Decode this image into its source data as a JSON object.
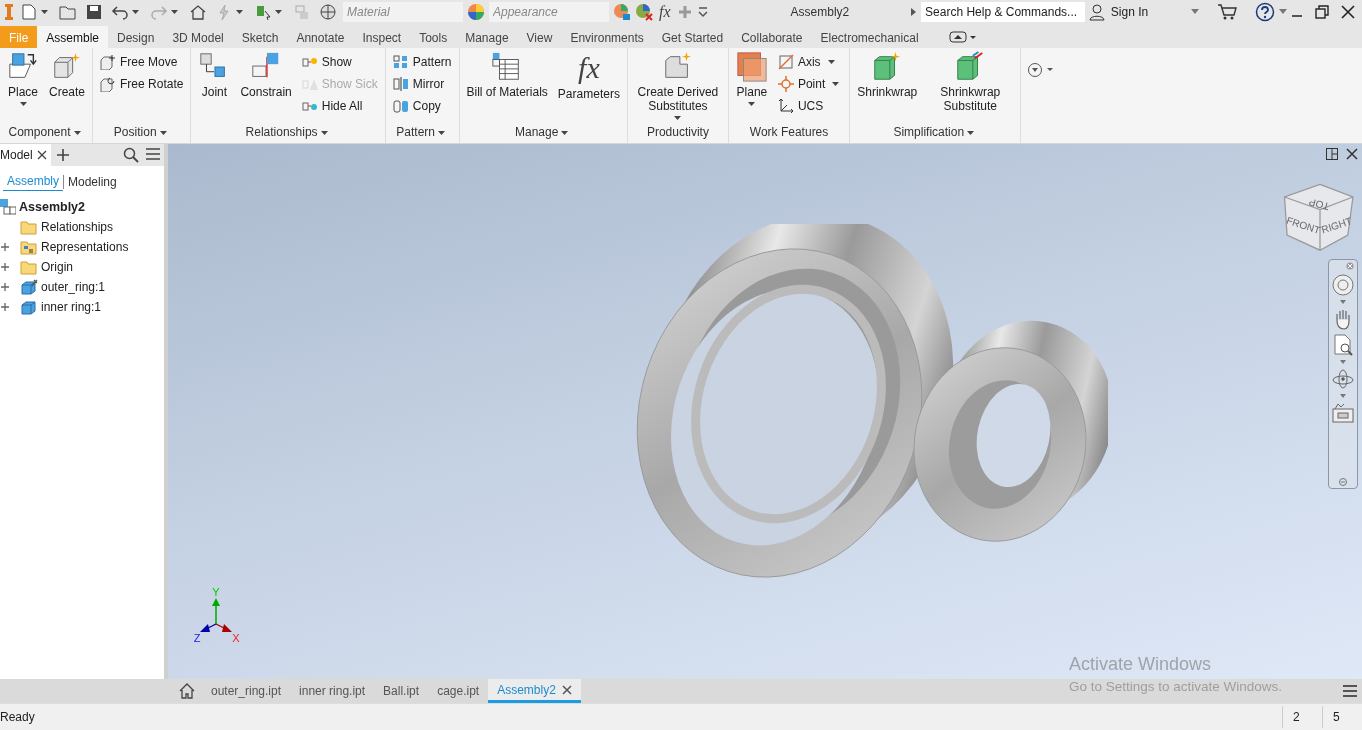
{
  "title_bar": {
    "material": {
      "placeholder": "Material"
    },
    "appearance": {
      "placeholder": "Appearance"
    },
    "formula_glyph": "fx",
    "document_title": "Assembly2",
    "search": {
      "placeholder": "Search Help & Commands..."
    },
    "sign_in": "Sign In"
  },
  "ribbon_tabs": [
    {
      "label": "File",
      "kind": "file",
      "selected": false
    },
    {
      "label": "Assemble",
      "kind": "tab",
      "selected": true
    },
    {
      "label": "Design",
      "kind": "tab",
      "selected": false
    },
    {
      "label": "3D Model",
      "kind": "tab",
      "selected": false
    },
    {
      "label": "Sketch",
      "kind": "tab",
      "selected": false
    },
    {
      "label": "Annotate",
      "kind": "tab",
      "selected": false
    },
    {
      "label": "Inspect",
      "kind": "tab",
      "selected": false
    },
    {
      "label": "Tools",
      "kind": "tab",
      "selected": false
    },
    {
      "label": "Manage",
      "kind": "tab",
      "selected": false
    },
    {
      "label": "View",
      "kind": "tab",
      "selected": false
    },
    {
      "label": "Environments",
      "kind": "tab",
      "selected": false
    },
    {
      "label": "Get Started",
      "kind": "tab",
      "selected": false
    },
    {
      "label": "Collaborate",
      "kind": "tab",
      "selected": false
    },
    {
      "label": "Electromechanical",
      "kind": "tab",
      "selected": false
    }
  ],
  "ribbon_panels": [
    {
      "label": "Component",
      "menu": true,
      "tools": [
        {
          "label": "Place",
          "kind": "large",
          "dropdown": true,
          "disabled": false
        },
        {
          "label": "Create",
          "kind": "large",
          "dropdown": false,
          "disabled": false
        }
      ]
    },
    {
      "label": "Position",
      "menu": true,
      "tools": [
        {
          "label": "Free Move",
          "kind": "small",
          "dropdown": false,
          "disabled": false
        },
        {
          "label": "Free Rotate",
          "kind": "small",
          "dropdown": false,
          "disabled": false
        }
      ]
    },
    {
      "label": "Relationships",
      "menu": true,
      "tools": [
        {
          "label": "Joint",
          "kind": "large",
          "dropdown": false,
          "disabled": false
        },
        {
          "label": "Constrain",
          "kind": "large",
          "dropdown": false,
          "disabled": false
        },
        {
          "label": "Show",
          "kind": "small",
          "dropdown": false,
          "disabled": false
        },
        {
          "label": "Show Sick",
          "kind": "small",
          "dropdown": false,
          "disabled": true
        },
        {
          "label": "Hide All",
          "kind": "small",
          "dropdown": false,
          "disabled": false
        }
      ]
    },
    {
      "label": "Pattern",
      "menu": true,
      "tools": [
        {
          "label": "Pattern",
          "kind": "small",
          "dropdown": false,
          "disabled": false
        },
        {
          "label": "Mirror",
          "kind": "small",
          "dropdown": false,
          "disabled": false
        },
        {
          "label": "Copy",
          "kind": "small",
          "dropdown": false,
          "disabled": false
        }
      ]
    },
    {
      "label": "Manage",
      "menu": true,
      "tools": [
        {
          "label": "Bill of Materials",
          "kind": "large",
          "dropdown": false,
          "disabled": false
        },
        {
          "label": "Parameters",
          "kind": "large",
          "dropdown": false,
          "disabled": false,
          "glyph": "fx"
        }
      ]
    },
    {
      "label": "Productivity",
      "menu": false,
      "tools": [
        {
          "label": "Create Derived Substitutes",
          "kind": "large",
          "dropdown": true,
          "disabled": false
        }
      ]
    },
    {
      "label": "Work Features",
      "menu": false,
      "tools": [
        {
          "label": "Plane",
          "kind": "large",
          "dropdown": true,
          "disabled": false
        },
        {
          "label": "Axis",
          "kind": "small",
          "dropdown": true,
          "disabled": false
        },
        {
          "label": "Point",
          "kind": "small",
          "dropdown": true,
          "disabled": false
        },
        {
          "label": "UCS",
          "kind": "small",
          "dropdown": false,
          "disabled": false
        }
      ]
    },
    {
      "label": "Simplification",
      "menu": true,
      "tools": [
        {
          "label": "Shrinkwrap",
          "kind": "large",
          "dropdown": false,
          "disabled": false
        },
        {
          "label": "Shrinkwrap Substitute",
          "kind": "large",
          "dropdown": false,
          "disabled": false
        }
      ]
    }
  ],
  "browser": {
    "tab": "Model",
    "subtabs": [
      {
        "label": "Assembly",
        "selected": true
      },
      {
        "label": "Modeling",
        "selected": false
      }
    ],
    "tree": {
      "label": "Assembly2",
      "children": [
        {
          "label": "Relationships",
          "kind": "folder",
          "expandable": false,
          "grounded": false
        },
        {
          "label": "Representations",
          "kind": "representations",
          "expandable": true,
          "grounded": false
        },
        {
          "label": "Origin",
          "kind": "folder",
          "expandable": true,
          "grounded": false
        },
        {
          "label": "outer_ring:1",
          "kind": "part",
          "expandable": true,
          "grounded": true
        },
        {
          "label": "inner ring:1",
          "kind": "part",
          "expandable": true,
          "grounded": false
        }
      ]
    }
  },
  "viewport": {
    "view_cube": [
      "TOP",
      "FRONT",
      "RIGHT"
    ],
    "axes": [
      "X",
      "Y",
      "Z"
    ]
  },
  "document_tabs": [
    {
      "label": "outer_ring.ipt",
      "selected": false
    },
    {
      "label": "inner ring.ipt",
      "selected": false
    },
    {
      "label": "Ball.ipt",
      "selected": false
    },
    {
      "label": "cage.ipt",
      "selected": false
    },
    {
      "label": "Assembly2",
      "selected": true
    }
  ],
  "activation_notice": {
    "title": "Activate Windows",
    "subtitle": "Go to Settings to activate Windows."
  },
  "status_bar": {
    "text": "Ready",
    "fields": [
      "2",
      "5"
    ]
  }
}
